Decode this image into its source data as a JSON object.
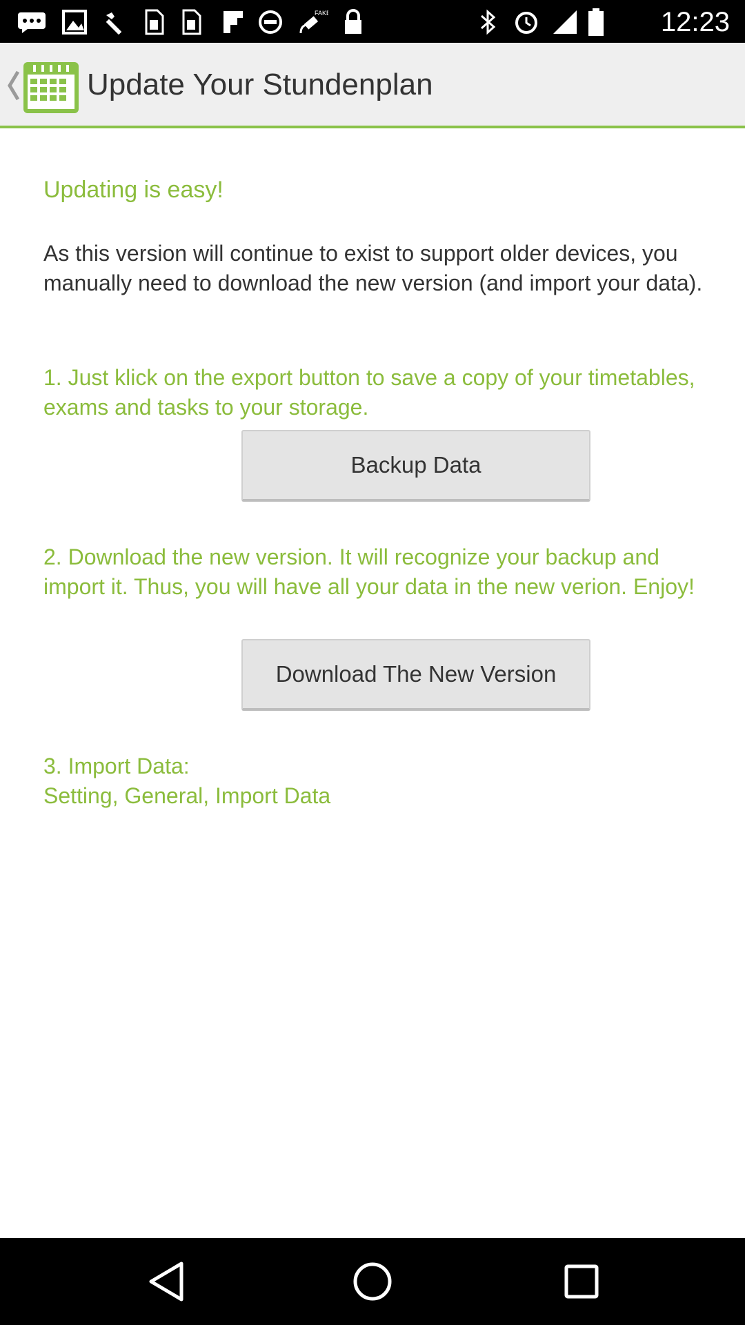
{
  "status_bar": {
    "time": "12:23",
    "icons": [
      "message-icon",
      "image-icon",
      "wrench-icon",
      "sim-icon",
      "sim-icon",
      "flipboard-icon",
      "blocked-icon",
      "fake-gps-icon",
      "lock-icon",
      "bluetooth-icon",
      "alarm-icon",
      "signal-icon",
      "battery-icon"
    ]
  },
  "action_bar": {
    "title": "Update Your Stundenplan",
    "accent_color": "#8ac249"
  },
  "content": {
    "heading": "Updating is easy!",
    "intro": "As this version will continue to exist to support older devices, you manually need to download the new version (and import your data).",
    "step1": "1. Just klick on the export button to save a copy of your timetables, exams and tasks to your storage.",
    "backup_button": "Backup Data",
    "step2": "2. Download the new version. It will recognize your backup and import it. Thus, you will have all your data in the new verion. Enjoy!",
    "download_button": "Download The New Version",
    "step3_line1": "3. Import Data:",
    "step3_line2": "Setting, General, Import Data",
    "text_green": "#8bbc3c"
  },
  "nav_bar": {
    "icons": [
      "back-icon",
      "home-icon",
      "recents-icon"
    ]
  }
}
